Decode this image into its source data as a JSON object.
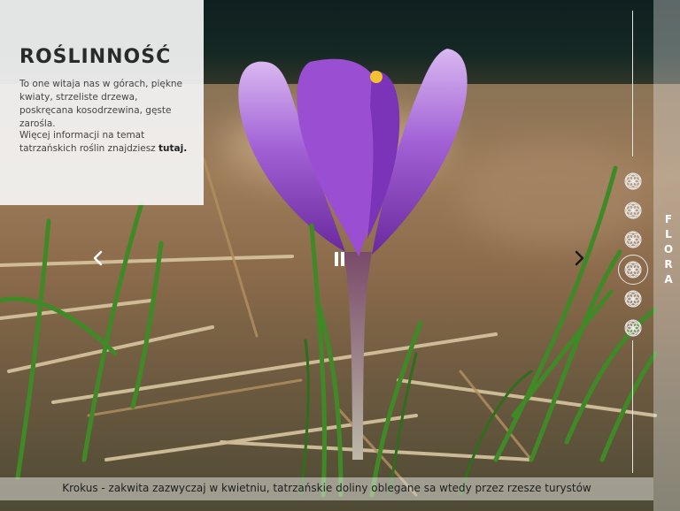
{
  "info": {
    "title": "ROŚLINNOŚĆ",
    "description": "To one witaja nas w górach, piękne kwiaty, strzeliste drzewa, poskręcana kosodrzewina, gęste zarośla.",
    "more_prefix": "Więcej informacji na temat tatrzańskich roślin znajdziesz ",
    "more_link": "tutaj."
  },
  "section_label": "FLORA",
  "nav": {
    "items": [
      {
        "icon": "flower-of-life-icon",
        "active": false
      },
      {
        "icon": "flower-of-life-icon",
        "active": false
      },
      {
        "icon": "flower-of-life-icon",
        "active": false
      },
      {
        "icon": "flower-of-life-icon",
        "active": true
      },
      {
        "icon": "flower-of-life-icon",
        "active": false
      },
      {
        "icon": "flower-of-life-icon",
        "active": false
      }
    ]
  },
  "slideshow": {
    "pause_icon": "pause-icon",
    "prev_icon": "chevron-left-icon",
    "next_icon": "chevron-right-icon"
  },
  "caption": "Krokus - zakwita zazwyczaj w kwietniu, tatrzańskie doliny oblegane sa wtedy przez rzesze turystów",
  "colors": {
    "petal": "#8e48c8",
    "petal_light": "#d7b6ee",
    "grass": "#3c8a2a",
    "panel_bg": "#f5f5f5"
  }
}
